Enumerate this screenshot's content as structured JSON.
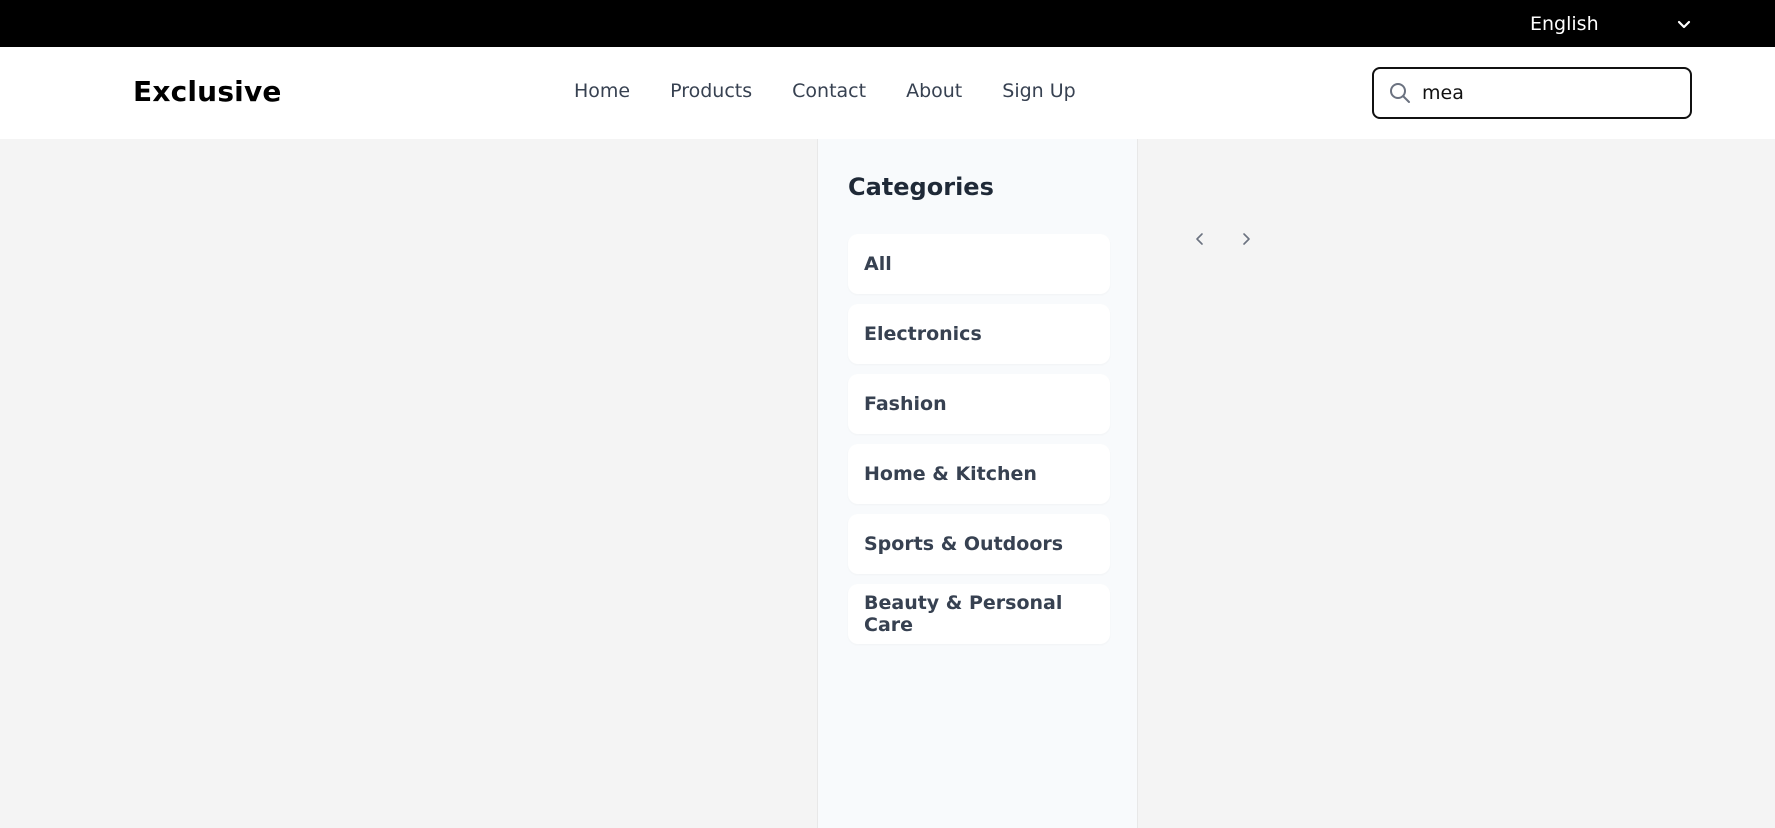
{
  "topbar": {
    "language": "English"
  },
  "header": {
    "logo": "Exclusive",
    "nav": [
      "Home",
      "Products",
      "Contact",
      "About",
      "Sign Up"
    ],
    "search": {
      "value": "mea",
      "placeholder": ""
    }
  },
  "sidebar": {
    "title": "Categories",
    "items": [
      "All",
      "Electronics",
      "Fashion",
      "Home & Kitchen",
      "Sports & Outdoors",
      "Beauty & Personal Care"
    ]
  },
  "icons": {
    "language_toggle": "chevron-down-icon",
    "search": "search-icon",
    "prev": "chevron-left-icon",
    "next": "chevron-right-icon"
  },
  "colors": {
    "topbar": "#000000",
    "text_dark": "#1f2937",
    "nav_text": "#374151",
    "sidebar_bg": "#f8fafc",
    "page_bg": "#f4f4f4"
  }
}
